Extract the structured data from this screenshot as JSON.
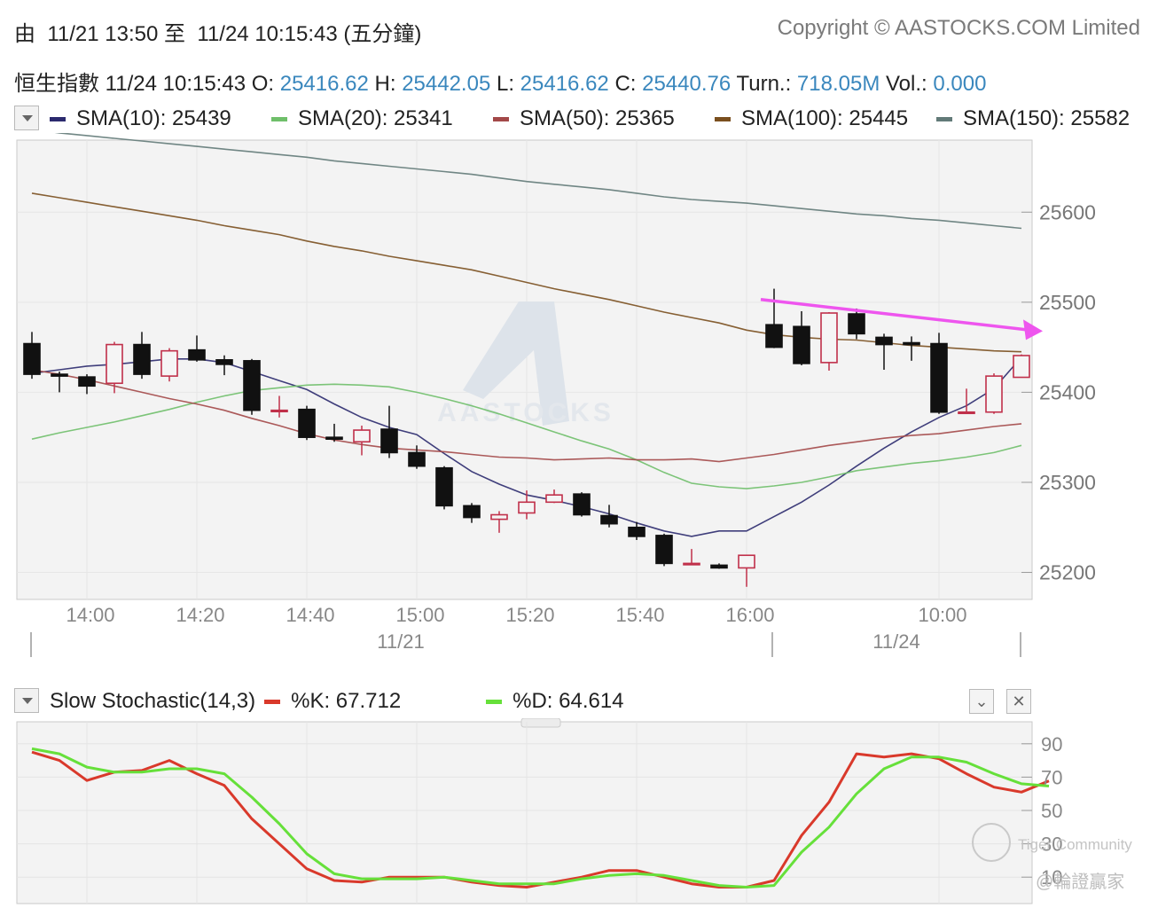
{
  "header": {
    "range_prefix": "由",
    "range_from": "11/21 13:50",
    "range_sep": "至",
    "range_to": "11/24 10:15:43",
    "range_suffix": "(五分鐘)",
    "copyright": "Copyright © AASTOCKS.COM Limited"
  },
  "quote": {
    "name": "恒生指數",
    "time": "11/24 10:15:43",
    "o_label": "O:",
    "o_value": "25416.62",
    "h_label": "H:",
    "h_value": "25442.05",
    "l_label": "L:",
    "l_value": "25416.62",
    "c_label": "C:",
    "c_value": "25440.76",
    "turn_label": "Turn.:",
    "turn_value": "718.05M",
    "vol_label": "Vol.:",
    "vol_value": "0.000"
  },
  "sma_legend": [
    {
      "label": "SMA(10): 25439",
      "color": "#2b2a6e"
    },
    {
      "label": "SMA(20): 25341",
      "color": "#6fbf6a"
    },
    {
      "label": "SMA(50): 25365",
      "color": "#a34848"
    },
    {
      "label": "SMA(100): 25445",
      "color": "#7a4f1e"
    },
    {
      "label": "SMA(150): 25582",
      "color": "#627a78"
    }
  ],
  "stoch_legend": {
    "title": "Slow Stochastic(14,3)",
    "k_label": "%K: 67.712",
    "d_label": "%D: 64.614",
    "k_color": "#d9392b",
    "d_color": "#66e03a"
  },
  "watermark": {
    "brand": "AASTOCKS",
    "community": "Tiger Community",
    "user": "@輪證贏家"
  },
  "chart_data": [
    {
      "type": "candlestick",
      "title": "",
      "ylim": [
        25170,
        25680
      ],
      "y_ticks": [
        "25600",
        "25500",
        "25400",
        "25300",
        "25200"
      ],
      "x_ticks": [
        "14:00",
        "14:20",
        "14:40",
        "15:00",
        "15:20",
        "15:40",
        "16:00",
        "10:00"
      ],
      "date_labels": [
        "11/21",
        "11/24"
      ],
      "colors": {
        "up": "#c0304a",
        "down": "#111111",
        "arrow": "#ee55ee"
      },
      "candles": [
        {
          "t": "13:50",
          "o": 25454,
          "h": 25467,
          "l": 25415,
          "c": 25420
        },
        {
          "t": "13:55",
          "o": 25420,
          "h": 25423,
          "l": 25400,
          "c": 25418
        },
        {
          "t": "14:00",
          "o": 25417,
          "h": 25420,
          "l": 25398,
          "c": 25407
        },
        {
          "t": "14:05",
          "o": 25410,
          "h": 25456,
          "l": 25399,
          "c": 25453
        },
        {
          "t": "14:10",
          "o": 25453,
          "h": 25467,
          "l": 25415,
          "c": 25420
        },
        {
          "t": "14:15",
          "o": 25418,
          "h": 25449,
          "l": 25412,
          "c": 25446
        },
        {
          "t": "14:20",
          "o": 25447,
          "h": 25463,
          "l": 25434,
          "c": 25436
        },
        {
          "t": "14:25",
          "o": 25436,
          "h": 25441,
          "l": 25419,
          "c": 25431
        },
        {
          "t": "14:30",
          "o": 25435,
          "h": 25437,
          "l": 25375,
          "c": 25380
        },
        {
          "t": "14:35",
          "o": 25379,
          "h": 25396,
          "l": 25372,
          "c": 25380
        },
        {
          "t": "14:40",
          "o": 25381,
          "h": 25385,
          "l": 25347,
          "c": 25350
        },
        {
          "t": "14:45",
          "o": 25350,
          "h": 25365,
          "l": 25345,
          "c": 25348
        },
        {
          "t": "14:50",
          "o": 25345,
          "h": 25363,
          "l": 25330,
          "c": 25358
        },
        {
          "t": "14:55",
          "o": 25359,
          "h": 25385,
          "l": 25327,
          "c": 25333
        },
        {
          "t": "15:00",
          "o": 25333,
          "h": 25341,
          "l": 25315,
          "c": 25318
        },
        {
          "t": "15:05",
          "o": 25316,
          "h": 25318,
          "l": 25270,
          "c": 25274
        },
        {
          "t": "15:10",
          "o": 25274,
          "h": 25277,
          "l": 25255,
          "c": 25261
        },
        {
          "t": "15:15",
          "o": 25259,
          "h": 25268,
          "l": 25244,
          "c": 25264
        },
        {
          "t": "15:20",
          "o": 25266,
          "h": 25291,
          "l": 25259,
          "c": 25278
        },
        {
          "t": "15:25",
          "o": 25278,
          "h": 25292,
          "l": 25277,
          "c": 25286
        },
        {
          "t": "15:30",
          "o": 25287,
          "h": 25289,
          "l": 25262,
          "c": 25264
        },
        {
          "t": "15:35",
          "o": 25263,
          "h": 25275,
          "l": 25250,
          "c": 25254
        },
        {
          "t": "15:40",
          "o": 25250,
          "h": 25256,
          "l": 25236,
          "c": 25240
        },
        {
          "t": "15:45",
          "o": 25241,
          "h": 25243,
          "l": 25207,
          "c": 25210
        },
        {
          "t": "15:50",
          "o": 25210,
          "h": 25226,
          "l": 25209,
          "c": 25210
        },
        {
          "t": "15:55",
          "o": 25208,
          "h": 25210,
          "l": 25204,
          "c": 25205
        },
        {
          "t": "16:00",
          "o": 25205,
          "h": 25217,
          "l": 25184,
          "c": 25219
        },
        {
          "t": "09:30",
          "o": 25475,
          "h": 25515,
          "l": 25449,
          "c": 25450
        },
        {
          "t": "09:35",
          "o": 25473,
          "h": 25490,
          "l": 25430,
          "c": 25432
        },
        {
          "t": "09:40",
          "o": 25433,
          "h": 25489,
          "l": 25424,
          "c": 25488
        },
        {
          "t": "09:45",
          "o": 25487,
          "h": 25493,
          "l": 25459,
          "c": 25465
        },
        {
          "t": "09:50",
          "o": 25461,
          "h": 25465,
          "l": 25425,
          "c": 25453
        },
        {
          "t": "09:55",
          "o": 25455,
          "h": 25462,
          "l": 25435,
          "c": 25453
        },
        {
          "t": "10:00",
          "o": 25454,
          "h": 25466,
          "l": 25376,
          "c": 25378
        },
        {
          "t": "10:05",
          "o": 25378,
          "h": 25404,
          "l": 25376,
          "c": 25378
        },
        {
          "t": "10:10",
          "o": 25378,
          "h": 25421,
          "l": 25376,
          "c": 25418
        },
        {
          "t": "10:15",
          "o": 25416.62,
          "h": 25442.05,
          "l": 25416.62,
          "c": 25440.76
        }
      ],
      "sma": {
        "SMA(10)": [
          25421,
          25425,
          25429,
          25431,
          25434,
          25437,
          25437,
          25433,
          25423,
          25413,
          25403,
          25387,
          25372,
          25361,
          25353,
          25332,
          25312,
          25298,
          25286,
          25280,
          25273,
          25265,
          25255,
          25246,
          25240,
          25246,
          25246,
          25262,
          25278,
          25297,
          25318,
          25338,
          25356,
          25372,
          25385,
          25404,
          25439
        ],
        "SMA(20)": [
          25348,
          25355,
          25361,
          25367,
          25374,
          25381,
          25389,
          25396,
          25402,
          25405,
          25408,
          25409,
          25408,
          25406,
          25400,
          25393,
          25385,
          25376,
          25366,
          25356,
          25346,
          25337,
          25325,
          25311,
          25299,
          25295,
          25293,
          25296,
          25300,
          25306,
          25313,
          25317,
          25321,
          25324,
          25328,
          25333,
          25341
        ],
        "SMA(50)": [
          25425,
          25420,
          25414,
          25407,
          25400,
          25393,
          25387,
          25380,
          25371,
          25363,
          25354,
          25347,
          25342,
          25338,
          25336,
          25334,
          25331,
          25328,
          25327,
          25325,
          25326,
          25327,
          25325,
          25325,
          25326,
          25323,
          25327,
          25331,
          25336,
          25341,
          25345,
          25349,
          25352,
          25354,
          25358,
          25362,
          25365
        ],
        "SMA(100)": [
          25621,
          25616,
          25611,
          25606,
          25601,
          25596,
          25591,
          25585,
          25580,
          25575,
          25568,
          25562,
          25557,
          25551,
          25546,
          25541,
          25536,
          25529,
          25522,
          25515,
          25509,
          25503,
          25496,
          25489,
          25483,
          25477,
          25469,
          25464,
          25461,
          25459,
          25458,
          25455,
          25452,
          25450,
          25448,
          25446,
          25445
        ],
        "SMA(150)": [
          25692,
          25688,
          25685,
          25682,
          25679,
          25676,
          25673,
          25670,
          25667,
          25664,
          25661,
          25657,
          25654,
          25651,
          25648,
          25645,
          25642,
          25638,
          25634,
          25631,
          25628,
          25625,
          25621,
          25617,
          25614,
          25612,
          25610,
          25607,
          25604,
          25601,
          25598,
          25596,
          25593,
          25591,
          25588,
          25585,
          25582
        ]
      },
      "annotation": {
        "type": "arrow",
        "from": {
          "t": "09:30",
          "y": 25503
        },
        "to": {
          "t": "10:20",
          "y": 25468
        }
      }
    },
    {
      "type": "line",
      "title": "Slow Stochastic(14,3)",
      "ylim": [
        0,
        100
      ],
      "y_ticks": [
        "90",
        "70",
        "50",
        "30",
        "10"
      ],
      "series": [
        {
          "name": "%K",
          "values": [
            85,
            80,
            68,
            73,
            74,
            80,
            72,
            65,
            45,
            30,
            15,
            8,
            7,
            10,
            10,
            10,
            7,
            5,
            4,
            7,
            10,
            14,
            14,
            10,
            6,
            4,
            4,
            8,
            35,
            55,
            84,
            82,
            84,
            81,
            72,
            64,
            61,
            67.712
          ]
        },
        {
          "name": "%D",
          "values": [
            87,
            84,
            76,
            73,
            73,
            75,
            75,
            72,
            58,
            42,
            24,
            12,
            9,
            9,
            9,
            10,
            8,
            6,
            6,
            6,
            9,
            11,
            12,
            11,
            8,
            5,
            4,
            5,
            25,
            40,
            60,
            75,
            82,
            82,
            79,
            72,
            66,
            64.614
          ]
        }
      ]
    }
  ]
}
